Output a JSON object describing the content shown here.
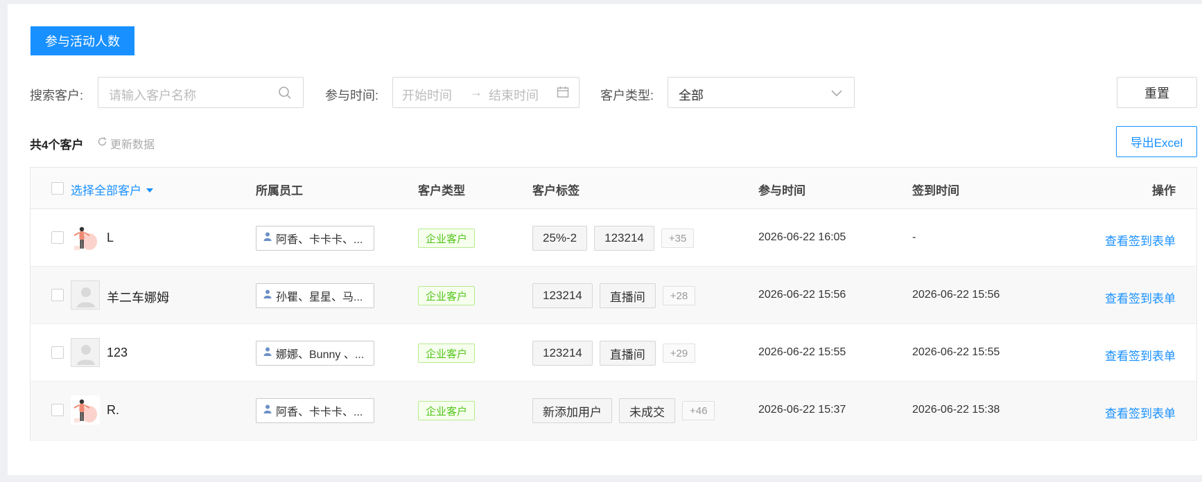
{
  "tab": {
    "label": "参与活动人数"
  },
  "filters": {
    "search_label": "搜索客户:",
    "search_placeholder": "请输入客户名称",
    "time_label": "参与时间:",
    "time_start_placeholder": "开始时间",
    "time_arrow": "→",
    "time_end_placeholder": "结束时间",
    "type_label": "客户类型:",
    "type_value": "全部",
    "reset_label": "重置"
  },
  "summary": {
    "total": "共4个客户",
    "refresh_label": "更新数据"
  },
  "export_label": "导出Excel",
  "table": {
    "headers": {
      "select_all": "选择全部客户",
      "staff": "所属员工",
      "type": "客户类型",
      "tags": "客户标签",
      "join_time": "参与时间",
      "sign_time": "签到时间",
      "action": "操作"
    },
    "rows": [
      {
        "name": "L",
        "avatar": "illustration",
        "staff": "阿香、卡卡卡、...",
        "type": "企业客户",
        "tags": [
          "25%-2",
          "123214"
        ],
        "more": "+35",
        "join_time": "2026-06-22 16:05",
        "sign_time": "-",
        "action": "查看签到表单"
      },
      {
        "name": "羊二车娜姆",
        "avatar": "default",
        "staff": "孙瞿、星星、马...",
        "type": "企业客户",
        "tags": [
          "123214",
          "直播间"
        ],
        "more": "+28",
        "join_time": "2026-06-22 15:56",
        "sign_time": "2026-06-22 15:56",
        "action": "查看签到表单"
      },
      {
        "name": "123",
        "avatar": "default",
        "staff": "娜娜、Bunny 、...",
        "type": "企业客户",
        "tags": [
          "123214",
          "直播间"
        ],
        "more": "+29",
        "join_time": "2026-06-22 15:55",
        "sign_time": "2026-06-22 15:55",
        "action": "查看签到表单"
      },
      {
        "name": "R.",
        "avatar": "illustration",
        "staff": "阿香、卡卡卡、...",
        "type": "企业客户",
        "tags": [
          "新添加用户",
          "未成交"
        ],
        "more": "+46",
        "join_time": "2026-06-22 15:37",
        "sign_time": "2026-06-22 15:38",
        "action": "查看签到表单"
      }
    ]
  },
  "colors": {
    "primary": "#1890ff",
    "tag_green": "#52c41a",
    "page_bg": "#eef0f4"
  }
}
